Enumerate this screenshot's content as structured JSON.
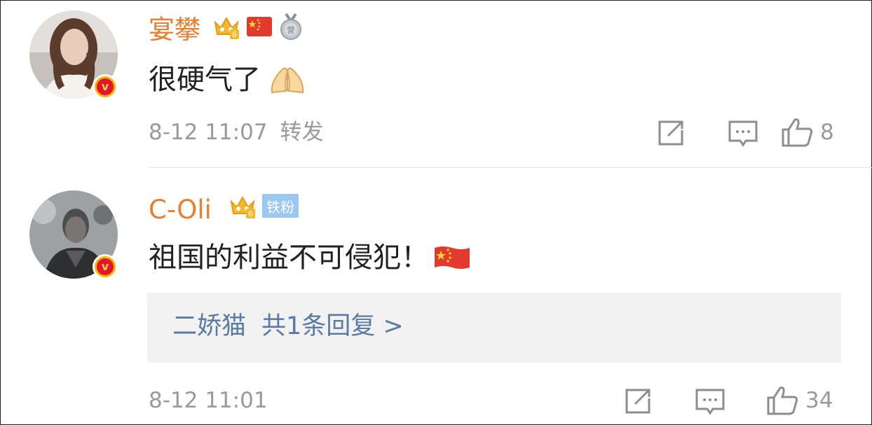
{
  "comments": [
    {
      "username": "宴攀",
      "text": "很硬气了",
      "emoji": "🙏",
      "date": "8-12 11:07",
      "forward_label": "转发",
      "likes": "8",
      "badges": [
        "crown-level-6-icon",
        "china-flag-icon",
        "medal-icon"
      ]
    },
    {
      "username": "C-Oli",
      "text": "祖国的利益不可侵犯！",
      "fan_badge": "铁粉",
      "date": "8-12 11:01",
      "likes": "34",
      "badges": [
        "crown-level-6-icon",
        "fan-badge"
      ],
      "reply": {
        "user": "二娇猫",
        "summary": "共1条回复 >"
      }
    }
  ],
  "colors": {
    "username": "#e77f2e",
    "meta": "#9a9a9a",
    "reply_link": "#5a7aa6",
    "fan_badge": "#9ac8f2",
    "verified_badge": "#e4142f"
  }
}
